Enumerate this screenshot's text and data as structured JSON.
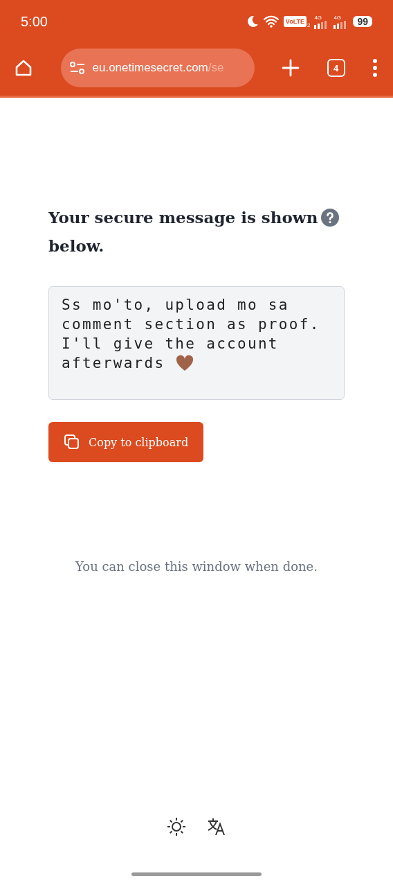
{
  "status_bar": {
    "time": "5:00",
    "volte": "VoLTE",
    "sim": "2",
    "networks": [
      "4G",
      "4G"
    ],
    "battery": "99"
  },
  "browser": {
    "url_host": "eu.onetimesecret.com",
    "url_path": "/se",
    "tab_count": "4"
  },
  "page": {
    "heading": "Your secure message is shown below.",
    "message_lines": [
      "Ss mo'to, upload mo sa",
      "comment section as proof.",
      "I'll give the account",
      "afterwards"
    ],
    "copy_button": "Copy to clipboard",
    "close_note": "You can close this window when done."
  }
}
